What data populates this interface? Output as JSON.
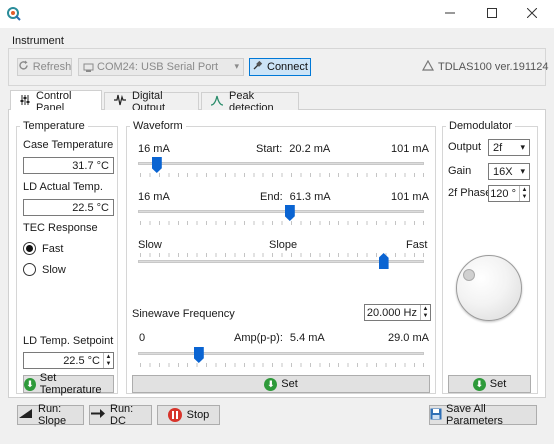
{
  "window": {
    "title": "",
    "icon": "app-logo-icon",
    "controls": [
      "minimize-icon",
      "maximize-icon",
      "close-icon"
    ]
  },
  "instrument": {
    "group_label": "Instrument",
    "refresh_label": "Refresh",
    "port_value": "COM24: USB Serial Port",
    "connect_label": "Connect",
    "version_label": "TDLAS100 ver.191124"
  },
  "tabs": [
    {
      "label": "Control Panel",
      "icon": "sliders-icon",
      "active": true
    },
    {
      "label": "Digital Output",
      "icon": "oscilloscope-icon",
      "active": false
    },
    {
      "label": "Peak detection",
      "icon": "peak-icon",
      "active": false
    }
  ],
  "temperature": {
    "group_label": "Temperature",
    "case_label": "Case Temperature",
    "case_value": "31.7 °C",
    "ld_actual_label": "LD Actual Temp.",
    "ld_actual_value": "22.5 °C",
    "tec_label": "TEC Response",
    "fast_label": "Fast",
    "slow_label": "Slow",
    "tec_selected": "Fast",
    "setpoint_label": "LD Temp. Setpoint",
    "setpoint_value": "22.5 °C",
    "set_button_label": "Set Temperature"
  },
  "waveform": {
    "group_label": "Waveform",
    "start": {
      "min": "16 mA",
      "label": "Start:",
      "value": "20.2 mA",
      "max": "101 mA",
      "fraction": 0.06
    },
    "end": {
      "min": "16 mA",
      "label": "End:",
      "value": "61.3 mA",
      "max": "101 mA",
      "fraction": 0.535
    },
    "slope": {
      "min": "Slow",
      "label": "Slope",
      "max": "Fast",
      "fraction": 0.87
    },
    "sine_label": "Sinewave Frequency",
    "sine_value": "20.000 Hz",
    "amp": {
      "min": "0",
      "label": "Amp(p-p):",
      "value": "5.4 mA",
      "max": "29.0 mA",
      "fraction": 0.21
    },
    "set_label": "Set"
  },
  "demodulator": {
    "group_label": "Demodulator",
    "output_label": "Output",
    "output_value": "2f",
    "gain_label": "Gain",
    "gain_value": "16X",
    "phase_label": "2f Phase",
    "phase_value": "120 °",
    "set_label": "Set"
  },
  "bottom": {
    "run_slope_label": "Run: Slope",
    "run_dc_label": "Run: DC",
    "stop_label": "Stop",
    "save_label": "Save All Parameters"
  }
}
